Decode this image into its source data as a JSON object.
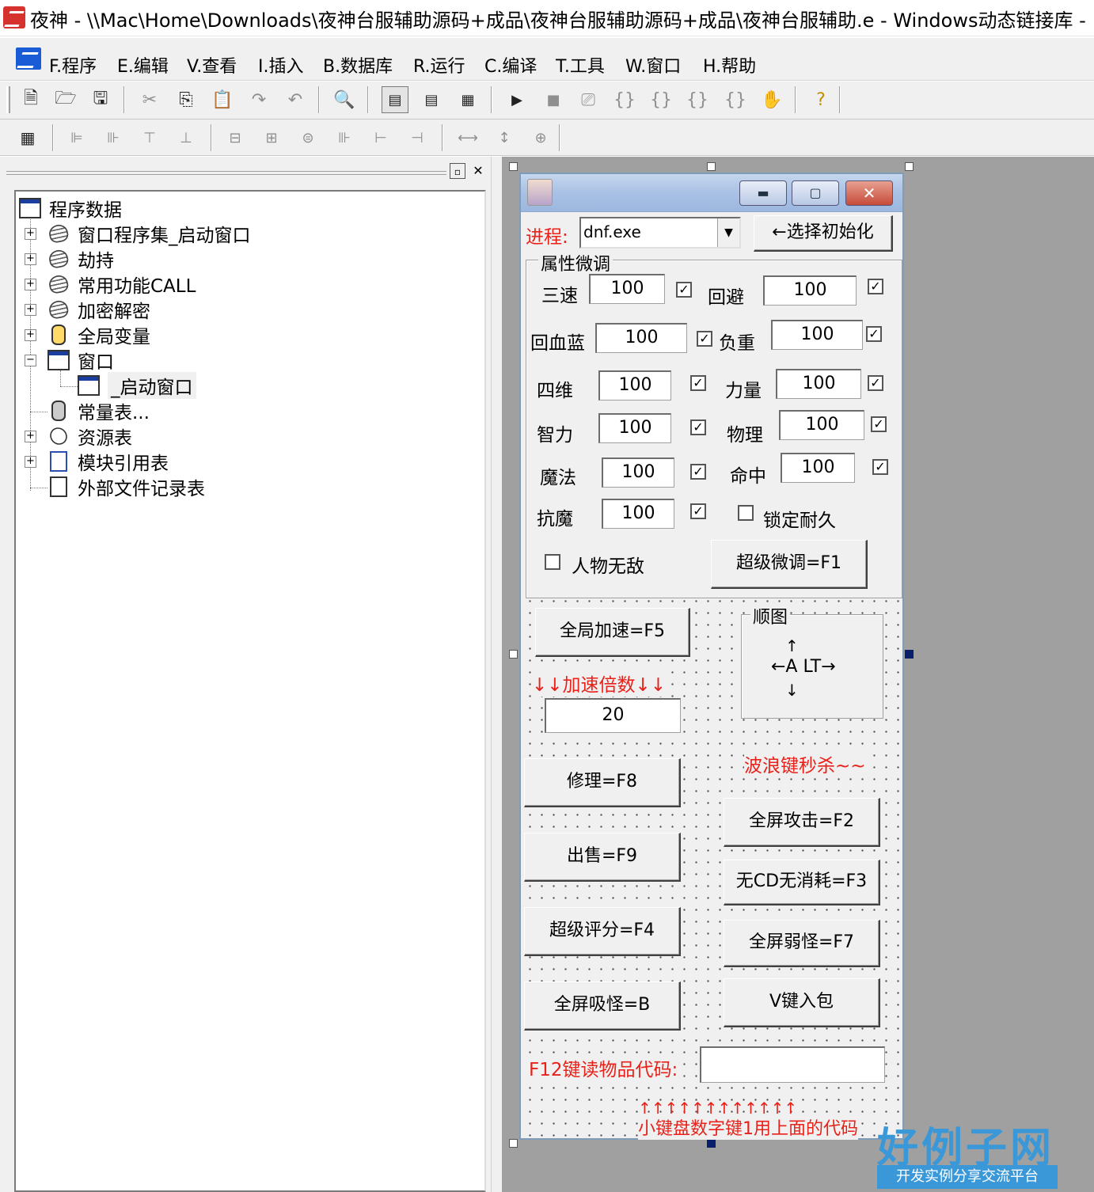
{
  "window": {
    "title": "夜神 - \\\\Mac\\Home\\Downloads\\夜神台服辅助源码+成品\\夜神台服辅助源码+成品\\夜神台服辅助.e - Windows动态链接库 -"
  },
  "menu": {
    "items": [
      "F.程序",
      "E.编辑",
      "V.查看",
      "I.插入",
      "B.数据库",
      "R.运行",
      "C.编译",
      "T.工具",
      "W.窗口",
      "H.帮助"
    ]
  },
  "toolbar1": {
    "icons": [
      "new-file-icon",
      "open-folder-icon",
      "save-icon",
      "cut-icon",
      "copy-icon",
      "paste-icon",
      "redo-icon",
      "undo-icon",
      "find-icon",
      "layout1-icon",
      "layout2-icon",
      "layout3-icon",
      "run-icon",
      "stop-icon",
      "step-icon",
      "step-into-icon",
      "step-over-icon",
      "step-out-icon",
      "run-to-cursor-icon",
      "hand-icon",
      "help-binoculars-icon"
    ]
  },
  "toolbar2": {
    "icons": [
      "form-icon",
      "align-left-icon",
      "align-right-icon",
      "align-top-icon",
      "align-bottom-icon",
      "center-h-icon",
      "center-v-icon",
      "align-mid-icon",
      "space-h-icon",
      "space-eq-h-icon",
      "space-eq-v-icon",
      "same-width-icon",
      "same-height-icon",
      "same-size-icon"
    ]
  },
  "tree": {
    "root": "程序数据",
    "items": [
      {
        "label": "窗口程序集_启动窗口",
        "icon": "module-stack-icon"
      },
      {
        "label": "劫持",
        "icon": "module-stack-icon"
      },
      {
        "label": "常用功能CALL",
        "icon": "module-stack-icon"
      },
      {
        "label": "加密解密",
        "icon": "module-stack-icon"
      },
      {
        "label": "全局变量",
        "icon": "global-var-icon"
      },
      {
        "label": "窗口",
        "icon": "window-icon"
      },
      {
        "label": "_启动窗口",
        "icon": "window-icon"
      },
      {
        "label": "常量表...",
        "icon": "const-table-icon"
      },
      {
        "label": "资源表",
        "icon": "resource-icon"
      },
      {
        "label": "模块引用表",
        "icon": "module-ref-icon"
      },
      {
        "label": "外部文件记录表",
        "icon": "external-file-icon"
      }
    ]
  },
  "form": {
    "process_label": "进程:",
    "process_value": "dnf.exe",
    "select_button": "←选择初始化",
    "attr_group_title": "属性微调",
    "fields": {
      "sansu": {
        "label": "三速",
        "value": "100"
      },
      "huibi": {
        "label": "回避",
        "value": "100"
      },
      "huixuelan": {
        "label": "回血蓝",
        "value": "100"
      },
      "fuzhong": {
        "label": "负重",
        "value": "100"
      },
      "siwei": {
        "label": "四维",
        "value": "100"
      },
      "liliang": {
        "label": "力量",
        "value": "100"
      },
      "zhili": {
        "label": "智力",
        "value": "100"
      },
      "wuli": {
        "label": "物理",
        "value": "100"
      },
      "mofa": {
        "label": "魔法",
        "value": "100"
      },
      "mingzhong": {
        "label": "命中",
        "value": "100"
      },
      "kangmo": {
        "label": "抗魔",
        "value": "100"
      }
    },
    "lock_durability": "锁定耐久",
    "invincible": "人物无敌",
    "super_tune": "超级微调=F1",
    "global_speed": "全局加速=F5",
    "speed_multiplier_label": "↓↓加速倍数↓↓",
    "speed_multiplier_value": "20",
    "map_group_title": "顺图",
    "map_up": "↑",
    "map_mid": "←A LT→",
    "map_down": "↓",
    "wave_key": "波浪键秒杀~~",
    "repair": "修理=F8",
    "fullscreen_attack": "全屏攻击=F2",
    "sell": "出售=F9",
    "no_cd": "无CD无消耗=F3",
    "super_score": "超级评分=F4",
    "weaken": "全屏弱怪=F7",
    "absorb": "全屏吸怪=B",
    "v_key": "V键入包",
    "f12_label": "F12键读物品代码:",
    "f12_value": "",
    "arrows": "↑↑↑↑↑↑↑↑↑↑↑↑",
    "numpad_hint": "小键盘数字键1用上面的代码"
  },
  "watermark": {
    "big": "好例子网",
    "small": "开发实例分享交流平台"
  }
}
